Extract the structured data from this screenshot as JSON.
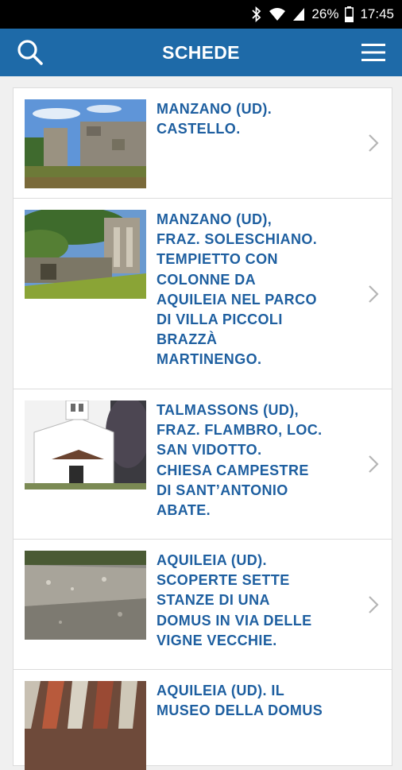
{
  "status_bar": {
    "battery": "26%",
    "time": "17:45"
  },
  "app_bar": {
    "title": "SCHEDE"
  },
  "items": [
    {
      "title_lines": [
        "MANZANO (UD).",
        "CASTELLO."
      ]
    },
    {
      "title_lines": [
        "MANZANO (UD),",
        "FRAZ. SOLESCHIANO.",
        "TEMPIETTO CON",
        "COLONNE DA",
        "AQUILEIA NEL PARCO",
        "DI VILLA PICCOLI",
        "BRAZZÀ",
        "MARTINENGO."
      ]
    },
    {
      "title_lines": [
        "TALMASSONS (UD),",
        "FRAZ. FLAMBRO, LOC.",
        "SAN VIDOTTO.",
        "CHIESA CAMPESTRE",
        "DI SANT’ANTONIO",
        "ABATE."
      ]
    },
    {
      "title_lines": [
        "AQUILEIA (UD).",
        "SCOPERTE SETTE",
        "STANZE DI UNA",
        "DOMUS IN VIA DELLE",
        "VIGNE VECCHIE."
      ]
    },
    {
      "title_lines": [
        "AQUILEIA (UD). IL",
        "MUSEO DELLA DOMUS"
      ]
    }
  ],
  "colors": {
    "app_bar": "#1e6aa8",
    "title_text": "#1e5fa0",
    "chevron": "#b5b5b5"
  }
}
